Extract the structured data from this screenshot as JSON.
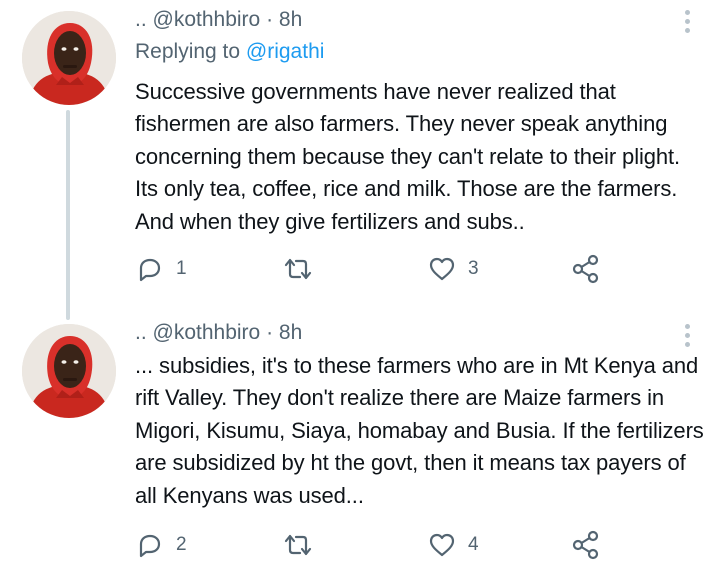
{
  "tweets": [
    {
      "handle_prefix": "..",
      "handle": "@kothhbiro",
      "separator": "·",
      "time": "8h",
      "replying_prefix": "Replying to",
      "replying_to": "@rigathi",
      "text": "Successive governments have never realized that fishermen are also farmers. They never speak anything concerning them because they can't relate to their plight. Its only tea, coffee, rice and milk. Those are the farmers. And when they give fertilizers and subs..",
      "reply_count": "1",
      "retweet_count": "",
      "like_count": "3"
    },
    {
      "handle_prefix": "..",
      "handle": "@kothhbiro",
      "separator": "·",
      "time": "8h",
      "text": "... subsidies, it's to these farmers who are in Mt Kenya and rift Valley. They don't realize there are Maize farmers in Migori, Kisumu, Siaya, homabay and Busia. If the fertilizers are subsidized by ht the govt, then it means tax payers of all Kenyans was used...",
      "reply_count": "2",
      "retweet_count": "",
      "like_count": "4"
    }
  ],
  "icons": {
    "reply": "reply-icon",
    "retweet": "retweet-icon",
    "like": "heart-icon",
    "share": "share-icon",
    "more": "more-icon"
  },
  "colors": {
    "text": "#0f1419",
    "secondary": "#536471",
    "link": "#1d9bf0",
    "thread_line": "#cfd9de",
    "hoodie": "#d9302a"
  }
}
